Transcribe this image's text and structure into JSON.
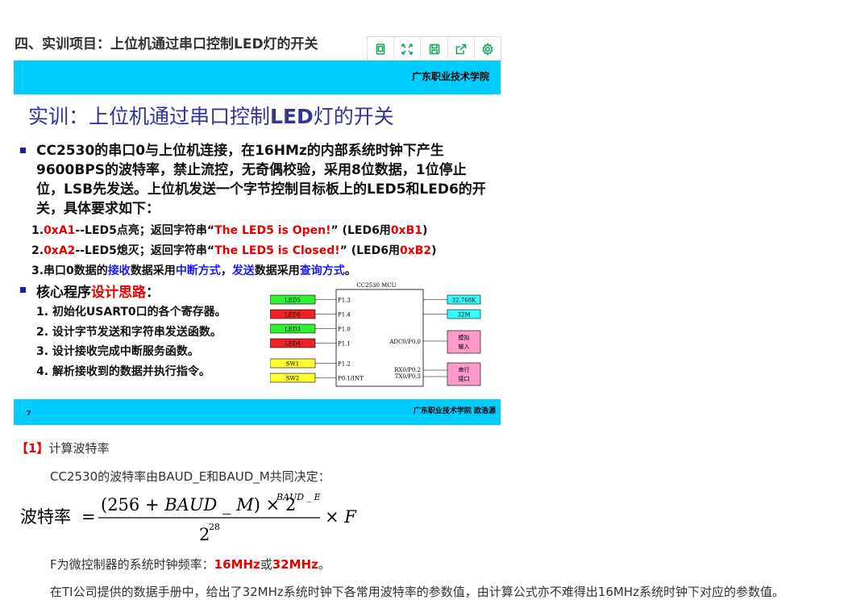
{
  "heading": "四、实训项目：上位机通过串口控制LED灯的开关",
  "toolbar": {
    "icons": [
      "copy-icon",
      "expand-icon",
      "save-icon",
      "share-icon",
      "settings-icon"
    ]
  },
  "slide": {
    "college": "广东职业技术学院",
    "title_prefix": "实训：上位机通过串口控制",
    "title_bold": "LED",
    "title_suffix": "灯的开关",
    "para": "CC2530的串口0与上位机连接，在16HMz的内部系统时钟下产生9600BPS的波特率，禁止流控，无奇偶校验，采用8位数据，1位停止位，LSB先发送。上位机发送一个字节控制目标板上的LED5和LED6的开关，具体要求如下：",
    "req1": {
      "n": "1.",
      "code": "0xA1",
      "mid": "--LED5点亮；返回字符串“",
      "msg": "The LED5 is Open!",
      "end": "”   (LED6用",
      "code2": "0xB1",
      "close": ")"
    },
    "req2": {
      "n": "2.",
      "code": "0xA2",
      "mid": "--LED5熄灭；返回字符串“",
      "msg": "The LED5 is Closed!",
      "end": "”  (LED6用",
      "code2": "0xB2",
      "close": ")"
    },
    "req3": {
      "a": "3.串口0数据的",
      "b": "接收",
      "c": "数据采用",
      "d": "中断方式",
      "e": "，",
      "f": "发送",
      "g": "数据采用",
      "h": "查询方式",
      "i": "。"
    },
    "sub_a": "核心程序",
    "sub_b": "设计思路",
    "sub_c": "：",
    "steps": [
      "1. 初始化USART0口的各个寄存器。",
      "2. 设计字节发送和字符串发送函数。",
      "3. 设计接收完成中断服务函数。",
      "4. 解析接收到的数据并执行指令。"
    ],
    "diagram": {
      "mcu": "CC2530  MCU",
      "left": [
        {
          "label": "LED5",
          "pin": "P1.3",
          "color": "#33ee33"
        },
        {
          "label": "LED6",
          "pin": "P1.4",
          "color": "#ee2222"
        },
        {
          "label": "LED3",
          "pin": "P1.0",
          "color": "#33ee33"
        },
        {
          "label": "LED4",
          "pin": "P1.1",
          "color": "#ee2222"
        },
        {
          "label": "SW1",
          "pin": "P1.2",
          "color": "#ffff33"
        },
        {
          "label": "SW2",
          "pin": "P0.1/INT",
          "color": "#ffff33"
        }
      ],
      "right_pins": [
        "ADC0/P0.0",
        "RX0/P0.2",
        "TX0/P0.3"
      ],
      "right_boxes": [
        {
          "label": "32.768K",
          "color": "#33ffff"
        },
        {
          "label": "32M",
          "color": "#33ffff"
        },
        {
          "label": "模拟",
          "label2": "输入",
          "color": "#ff99cc"
        },
        {
          "label": "串行",
          "label2": "接口",
          "color": "#ff99cc"
        }
      ]
    },
    "page": "7",
    "author": "广东职业技术学院  欧浩源"
  },
  "section": {
    "label": "【1】",
    "title": "计算波特率"
  },
  "text1": "CC2530的波特率由BAUD_E和BAUD_M共同决定：",
  "formula": {
    "lhs": "波特率",
    "eq": "=",
    "num_a": "(256 + ",
    "num_b": "BAUD _ M",
    "num_c": ") × 2",
    "exp": "BAUD _ E",
    "den": "2",
    "den_exp": "28",
    "tail": "× F"
  },
  "text2": {
    "a": "F为微控制器的系统时钟频率：",
    "b": "16MHz",
    "c": "或",
    "d": "32MHz",
    "e": "。"
  },
  "text3": "在TI公司提供的数据手册中，给出了32MHz系统时钟下各常用波特率的参数值，由计算公式亦不难得出16MHz系统时钟下对应的参数值。"
}
